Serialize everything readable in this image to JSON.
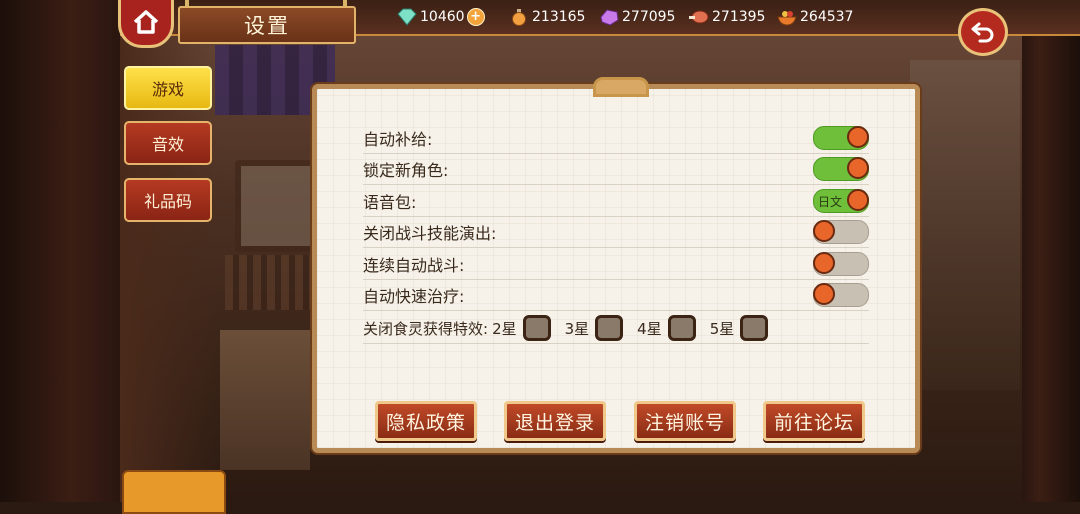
{
  "header": {
    "title": "设置"
  },
  "resources": [
    {
      "icon": "diamond-icon",
      "value": "10460",
      "has_plus": true
    },
    {
      "icon": "potion-icon",
      "value": "213165"
    },
    {
      "icon": "crystal-icon",
      "value": "277095"
    },
    {
      "icon": "meat-icon",
      "value": "271395"
    },
    {
      "icon": "fruit-bowl-icon",
      "value": "264537"
    }
  ],
  "tabs": [
    {
      "label": "游戏",
      "active": true
    },
    {
      "label": "音效",
      "active": false
    },
    {
      "label": "礼品码",
      "active": false
    }
  ],
  "settings": [
    {
      "label": "自动补给:",
      "on": true,
      "toggle_text": ""
    },
    {
      "label": "锁定新角色:",
      "on": true,
      "toggle_text": ""
    },
    {
      "label": "语音包:",
      "on": true,
      "toggle_text": "日文"
    },
    {
      "label": "关闭战斗技能演出:",
      "on": false,
      "toggle_text": ""
    },
    {
      "label": "连续自动战斗:",
      "on": false,
      "toggle_text": ""
    },
    {
      "label": "自动快速治疗:",
      "on": false,
      "toggle_text": ""
    }
  ],
  "effects_row": {
    "label": "关闭食灵获得特效:",
    "options": [
      "2星",
      "3星",
      "4星",
      "5星"
    ]
  },
  "buttons": [
    "隐私政策",
    "退出登录",
    "注销账号",
    "前往论坛"
  ],
  "colors": {
    "toggle_on": "#6fbf3a",
    "toggle_off": "#c9c0b4",
    "knob": "#e8662a",
    "active_tab": "#ffe14a",
    "button": "#b8401f"
  }
}
